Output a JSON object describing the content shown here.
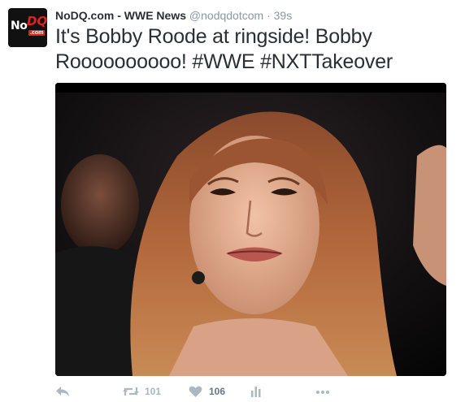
{
  "account": {
    "logo_text_left": "No",
    "logo_text_right": "DQ",
    "logo_text_suffix": ".com",
    "display_name": "NoDQ.com - WWE News",
    "handle": "@nodqdotcom",
    "separator": "·",
    "time": "39s"
  },
  "tweet": {
    "text": "It's Bobby Roode at ringside! Bobby Roooooooooo! #WWE #NXTTakeover"
  },
  "media": {
    "icon": "photo-icon"
  },
  "actions": {
    "reply_icon": "reply-icon",
    "retweet_icon": "retweet-icon",
    "retweet_count": "101",
    "like_icon": "heart-icon",
    "like_count": "106",
    "analytics_icon": "analytics-icon",
    "more_icon": "more-icon"
  },
  "colors": {
    "text": "#292f33",
    "muted": "#8899a6",
    "action": "#aab8c2",
    "brand_red": "#d8261f"
  }
}
